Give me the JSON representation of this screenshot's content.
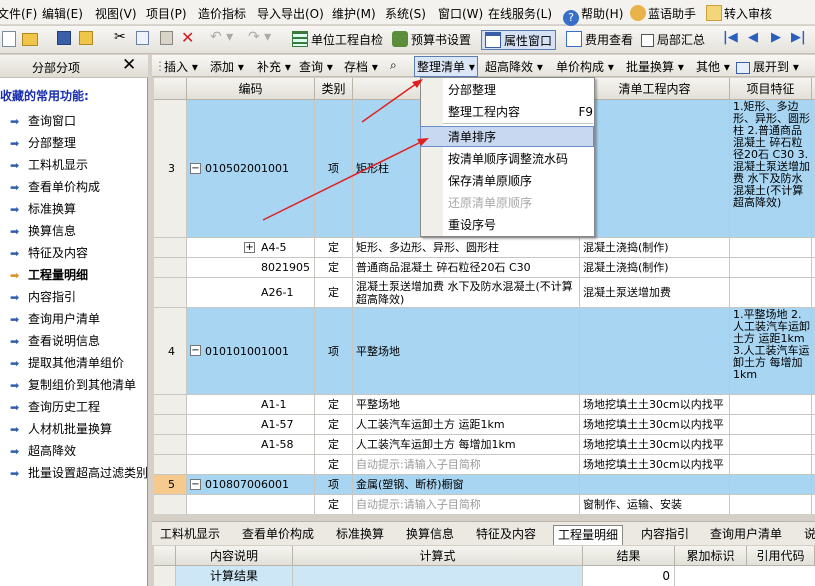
{
  "menubar": {
    "items": [
      "文件(F)",
      "编辑(E)",
      "视图(V)",
      "项目(P)",
      "造价指标",
      "导入导出(O)",
      "维护(M)",
      "系统(S)",
      "窗口(W)",
      "在线服务(L)",
      "帮助(H)",
      "蓝语助手",
      "转入审核"
    ]
  },
  "toolbar1": {
    "self_check": "单位工程自检",
    "budget_settings": "预算书设置",
    "property_window": "属性窗口",
    "fee_view": "费用查看",
    "local_summary": "局部汇总"
  },
  "left_panel": {
    "tab": "分部分项",
    "section_title": "我收藏的常用功能:",
    "items": [
      "查询窗口",
      "分部整理",
      "工料机显示",
      "查看单价构成",
      "标准换算",
      "换算信息",
      "特征及内容",
      "工程量明细",
      "内容指引",
      "查询用户清单",
      "查看说明信息",
      "提取其他清单组价",
      "复制组价到其他清单",
      "查询历史工程",
      "人材机批量换算",
      "超高降效",
      "批量设置超高过滤类别"
    ]
  },
  "toolbar2": {
    "items": [
      "插入",
      "添加",
      "补充",
      "查询",
      "存档",
      "整理清单",
      "超高降效",
      "单价构成",
      "批量换算",
      "其他",
      "展开到"
    ]
  },
  "dropdown": {
    "items": [
      "分部整理",
      "整理工程内容",
      "清单排序",
      "按清单顺序调整流水码",
      "保存清单原顺序",
      "还原清单原顺序",
      "重设序号"
    ],
    "shortcut": "F9"
  },
  "grid": {
    "headers": [
      "编码",
      "类别",
      "",
      "清单工程内容",
      "项目特征"
    ],
    "rows": [
      {
        "no": "3",
        "code": "010502001001",
        "type": "项",
        "name": "矩形柱",
        "content": "",
        "feature": "1.矩形、多边形、异形、圆形柱 2.普通商品混凝土 碎石粒径20石 C30 3.混凝土泵送增加费 水下及防水混凝土(不计算超高降效)"
      },
      {
        "no": "",
        "code": "A4-5",
        "type": "定",
        "name": "矩形、多边形、异形、圆形柱",
        "content": "混凝土浇捣(制作)",
        "feature": ""
      },
      {
        "no": "",
        "code": "8021905",
        "type": "定",
        "name": "普通商品混凝土 碎石粒径20石 C30",
        "content": "混凝土浇捣(制作)",
        "feature": ""
      },
      {
        "no": "",
        "code": "A26-1",
        "type": "定",
        "name": "混凝土泵送增加费 水下及防水混凝土(不计算超高降效)",
        "content": "混凝土泵送增加费",
        "feature": ""
      },
      {
        "no": "4",
        "code": "010101001001",
        "type": "项",
        "name": "平整场地",
        "content": "",
        "feature": "1.平整场地 2.人工装汽车运卸土方 运距1km 3.人工装汽车运卸土方 每增加1km"
      },
      {
        "no": "",
        "code": "A1-1",
        "type": "定",
        "name": "平整场地",
        "content": "场地挖填土土30cm以内找平",
        "feature": ""
      },
      {
        "no": "",
        "code": "A1-57",
        "type": "定",
        "name": "人工装汽车运卸土方 运距1km",
        "content": "场地挖填土土30cm以内找平",
        "feature": ""
      },
      {
        "no": "",
        "code": "A1-58",
        "type": "定",
        "name": "人工装汽车运卸土方 每增加1km",
        "content": "场地挖填土土30cm以内找平",
        "feature": ""
      },
      {
        "no": "",
        "code": "",
        "type": "定",
        "name": "自动提示:请输入子目简称",
        "content": "场地挖填土土30cm以内找平",
        "feature": ""
      },
      {
        "no": "5",
        "code": "010807006001",
        "type": "项",
        "name": "金属(塑钢、断桥)橱窗",
        "content": "",
        "feature": ""
      },
      {
        "no": "",
        "code": "",
        "type": "定",
        "name": "自动提示:请输入子目简称",
        "content": "窗制作、运输、安装",
        "feature": ""
      }
    ]
  },
  "bottom_tabs": [
    "工料机显示",
    "查看单价构成",
    "标准换算",
    "换算信息",
    "特征及内容",
    "工程量明细",
    "内容指引",
    "查询用户清单",
    "说明"
  ],
  "bottom_grid": {
    "headers": [
      "内容说明",
      "计算式",
      "结果",
      "累加标识",
      "引用代码"
    ],
    "row": {
      "desc": "计算结果",
      "formula": "",
      "result": "0"
    }
  }
}
